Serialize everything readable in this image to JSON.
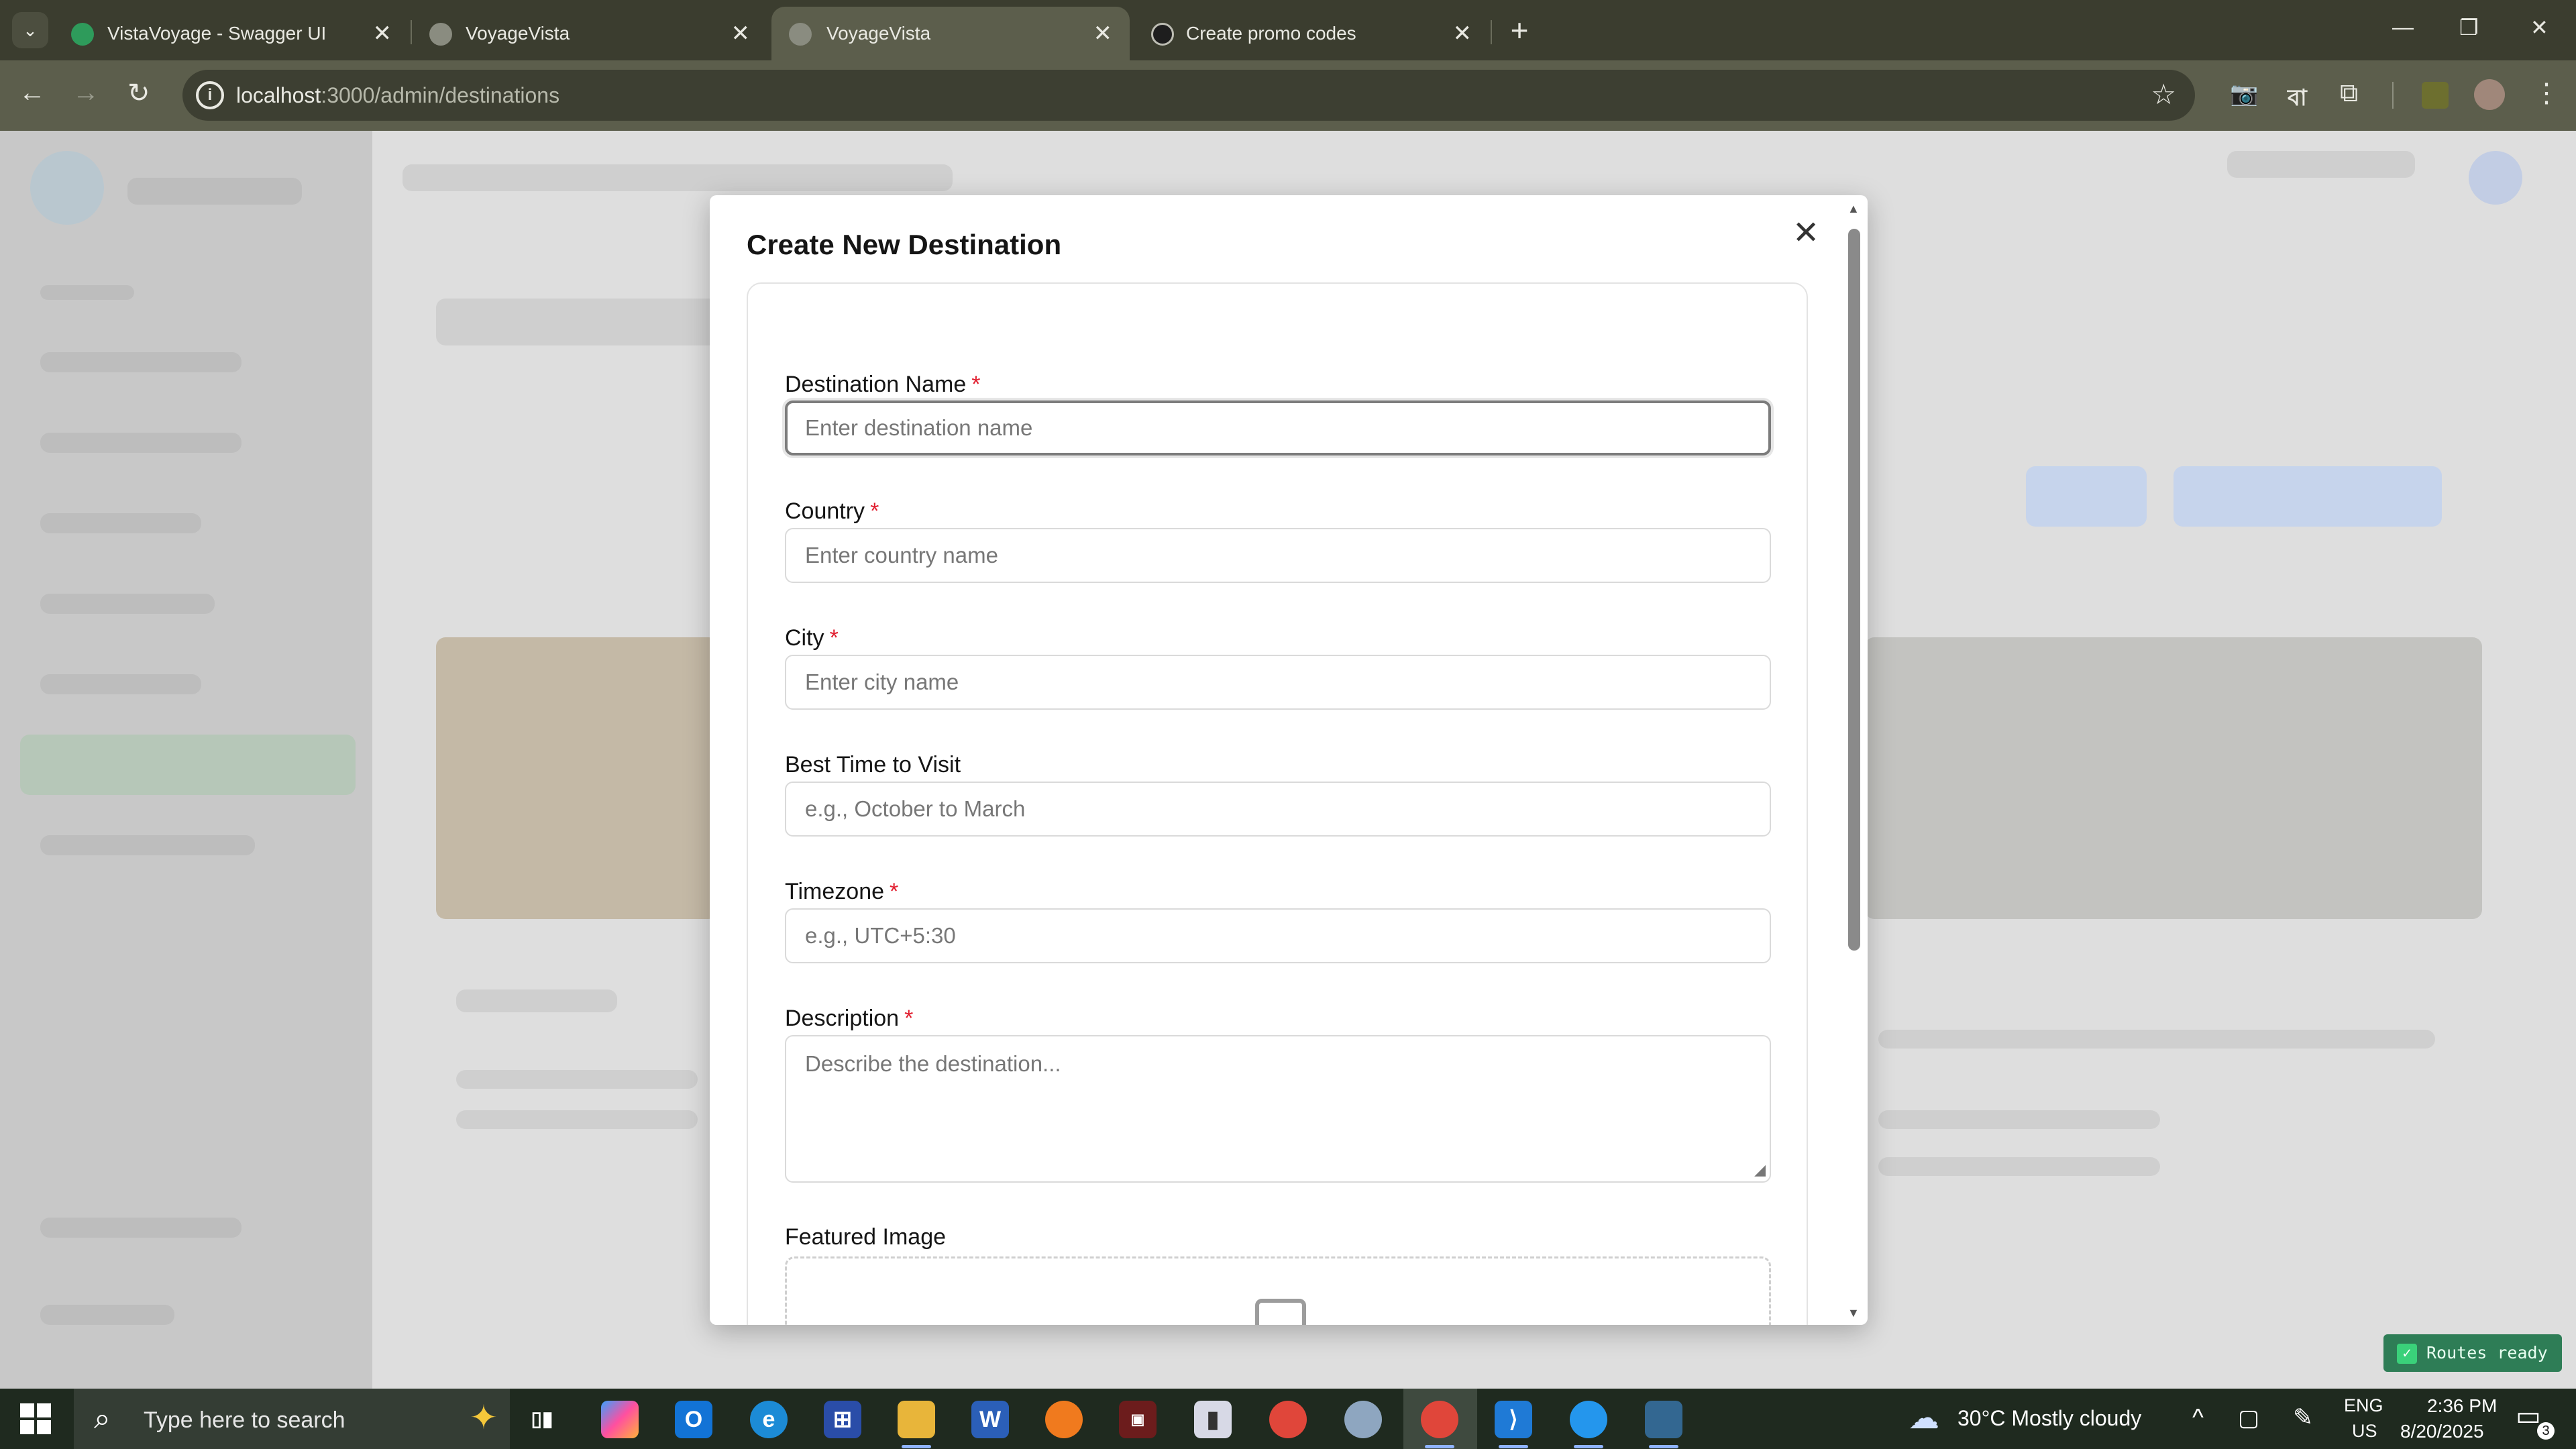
{
  "browser": {
    "tabs": [
      {
        "title": "VistaVoyage - Swagger UI",
        "icon": "swagger-favicon-icon",
        "active": false
      },
      {
        "title": "VoyageVista",
        "icon": "globe-favicon-icon",
        "active": false
      },
      {
        "title": "VoyageVista",
        "icon": "globe-favicon-icon",
        "active": true
      },
      {
        "title": "Create promo codes",
        "icon": "openai-favicon-icon",
        "active": false
      }
    ],
    "url_host": "localhost",
    "url_path": ":3000/admin/destinations"
  },
  "modal": {
    "title": "Create New Destination",
    "fields": [
      {
        "label": "Destination Name",
        "required": "*",
        "placeholder": "Enter destination name"
      },
      {
        "label": "Country",
        "required": "*",
        "placeholder": "Enter country name"
      },
      {
        "label": "City",
        "required": "*",
        "placeholder": "Enter city name"
      },
      {
        "label": "Best Time to Visit",
        "required": "",
        "placeholder": "e.g., October to March"
      },
      {
        "label": "Timezone",
        "required": "*",
        "placeholder": "e.g., UTC+5:30"
      },
      {
        "label": "Description",
        "required": "*",
        "placeholder": "Describe the destination..."
      }
    ],
    "featured_image_label": "Featured Image"
  },
  "toast": {
    "text": "Routes ready"
  },
  "taskbar": {
    "search_placeholder": "Type here to search",
    "weather": "30°C  Mostly cloudy",
    "lang_line1": "ENG",
    "lang_line2": "US",
    "time": "2:36 PM",
    "date": "8/20/2025",
    "notifications": "3"
  }
}
